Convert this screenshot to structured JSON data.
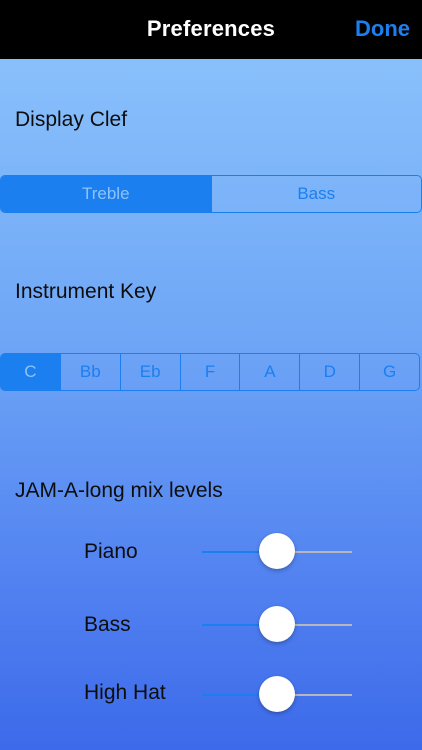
{
  "navbar": {
    "title": "Preferences",
    "done_label": "Done"
  },
  "display_clef": {
    "label": "Display Clef",
    "options": [
      "Treble",
      "Bass"
    ],
    "selected": "Treble"
  },
  "instrument_key": {
    "label": "Instrument Key",
    "options": [
      "C",
      "Bb",
      "Eb",
      "F",
      "A",
      "D",
      "G"
    ],
    "selected": "C"
  },
  "mix_levels": {
    "label": "JAM-A-long mix levels",
    "sliders": [
      {
        "label": "Piano",
        "value": 0.5
      },
      {
        "label": "Bass",
        "value": 0.5
      },
      {
        "label": "High Hat",
        "value": 0.5
      }
    ]
  },
  "colors": {
    "accent": "#1b7ff0",
    "navbar_bg": "#000000",
    "background_top": "#8ec6fd",
    "background_bottom": "#3c6aea"
  }
}
